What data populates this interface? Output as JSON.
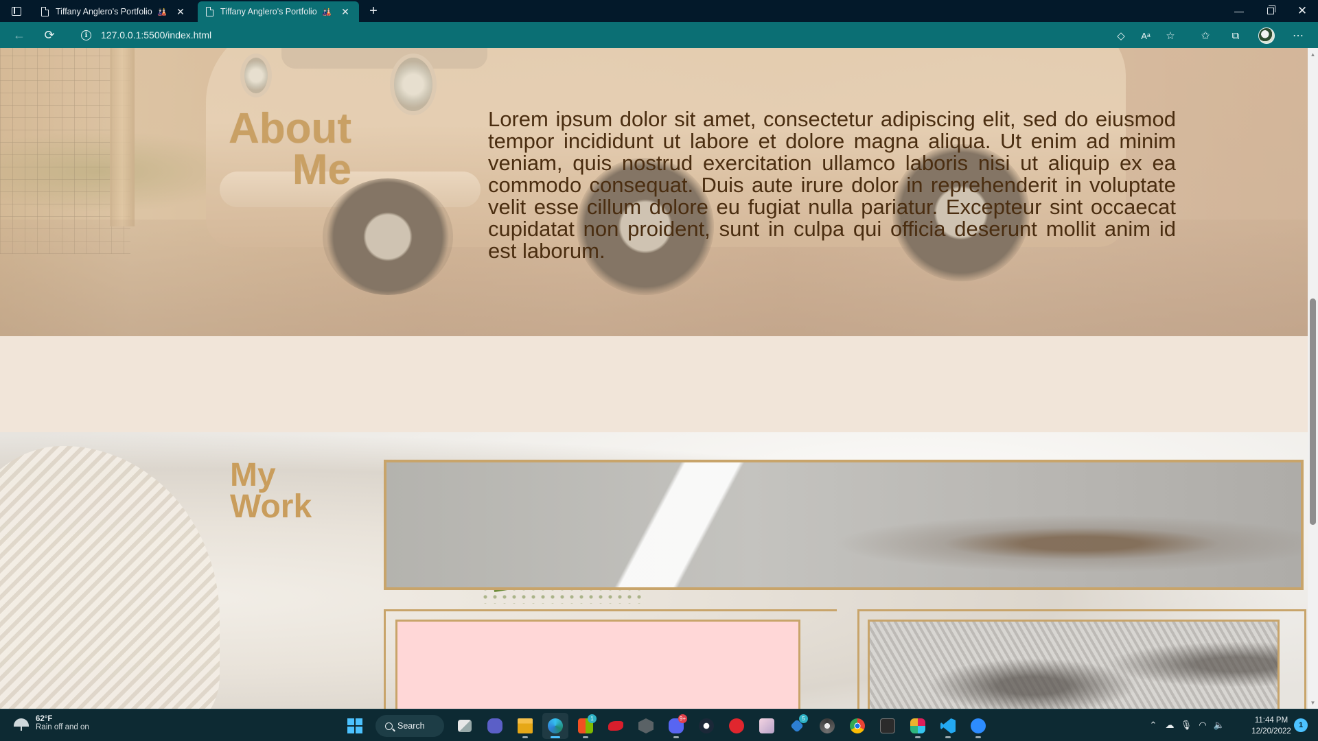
{
  "browser": {
    "tabs": [
      {
        "title": "Tiffany Anglero's Portfolio",
        "favicon_suffix": "🎎",
        "active": false
      },
      {
        "title": "Tiffany Anglero's Portfolio",
        "favicon_suffix": "🎎",
        "active": true
      }
    ],
    "new_tab_label": "+",
    "address": {
      "url": "127.0.0.1:5500/index.html"
    },
    "window_controls": {
      "minimize": "—",
      "close": "✕"
    },
    "toolbar_icons": [
      "extensions-icon",
      "read-aloud-icon",
      "add-favorite-icon",
      "favorites-icon",
      "collections-icon",
      "profile-avatar",
      "more-menu-icon"
    ],
    "accent_color": "#0b6f74"
  },
  "page": {
    "about": {
      "title_line1": "About",
      "title_line2": "Me",
      "body": "Lorem ipsum dolor sit amet, consectetur adipiscing elit, sed do eiusmod tempor incididunt ut labore et dolore magna aliqua. Ut enim ad minim veniam, quis nostrud exercitation ullamco laboris nisi ut aliquip ex ea commodo consequat. Duis aute irure dolor in reprehenderit in voluptate velit esse cillum dolore eu fugiat nulla pariatur. Excepteur sint occaecat cupidatat non proident, sunt in culpa qui officia deserunt mollit anim id est laborum."
    },
    "work": {
      "title_line1": "My",
      "title_line2": "Work"
    },
    "colors": {
      "heading_gold": "#c9a064",
      "body_brown": "#4a2d10",
      "frame_gold": "#c8a46a",
      "card_pink": "#ffd7d7",
      "cream_background": "#f1e5d9"
    }
  },
  "taskbar": {
    "weather": {
      "temp": "62°F",
      "condition": "Rain off and on"
    },
    "search_label": "Search",
    "apps": [
      {
        "name": "start-button"
      },
      {
        "name": "search"
      },
      {
        "name": "task-view"
      },
      {
        "name": "teams-chat"
      },
      {
        "name": "file-explorer"
      },
      {
        "name": "edge-browser",
        "active": true
      },
      {
        "name": "microsoft-store",
        "badge": "1"
      },
      {
        "name": "app-red"
      },
      {
        "name": "app-gray"
      },
      {
        "name": "discord",
        "badge": "9+"
      },
      {
        "name": "steam"
      },
      {
        "name": "app-red-2"
      },
      {
        "name": "app-anime"
      },
      {
        "name": "app-blue",
        "badge": "5"
      },
      {
        "name": "chrome-dev"
      },
      {
        "name": "chrome"
      },
      {
        "name": "terminal"
      },
      {
        "name": "slack"
      },
      {
        "name": "vscode"
      },
      {
        "name": "zoom"
      }
    ],
    "clock": {
      "time": "11:44 PM",
      "date": "12/20/2022"
    },
    "notifications": "1"
  }
}
